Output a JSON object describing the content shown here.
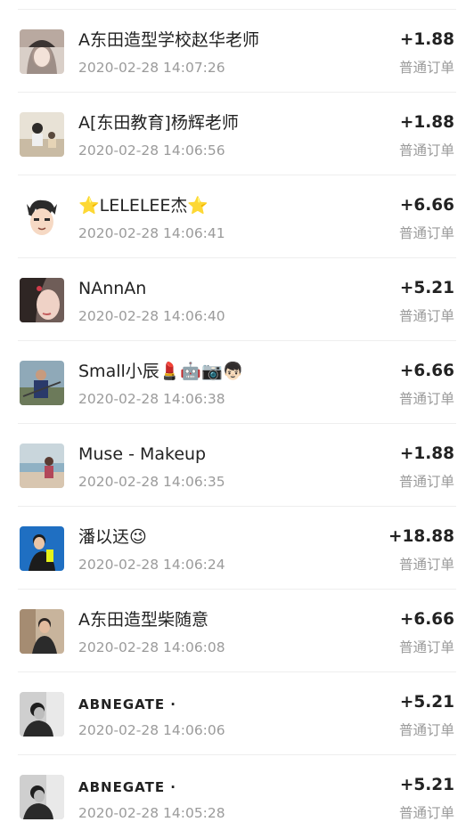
{
  "orders": [
    {
      "name": "A东田造型学校赵华老师",
      "time": "2020-02-28 14:07:26",
      "amount": "+1.88",
      "type": "普通订单",
      "avatar": "avatar-girl-hat-icon"
    },
    {
      "name": "A[东田教育]杨辉老师",
      "time": "2020-02-28 14:06:56",
      "amount": "+1.88",
      "type": "普通订单",
      "avatar": "avatar-classroom-icon"
    },
    {
      "name": "⭐LELELEE杰⭐",
      "time": "2020-02-28 14:06:41",
      "amount": "+6.66",
      "type": "普通订单",
      "avatar": "avatar-cartoon-boy-icon"
    },
    {
      "name": "NAnnAn",
      "time": "2020-02-28 14:06:40",
      "amount": "+5.21",
      "type": "普通订单",
      "avatar": "avatar-girl-portrait-icon"
    },
    {
      "name": "Small小辰💄🤖📷👦🏻",
      "time": "2020-02-28 14:06:38",
      "amount": "+6.66",
      "type": "普通订单",
      "avatar": "avatar-man-outdoor-icon"
    },
    {
      "name": "Muse - Makeup",
      "time": "2020-02-28 14:06:35",
      "amount": "+1.88",
      "type": "普通订单",
      "avatar": "avatar-beach-woman-icon"
    },
    {
      "name": "潘以迗😉",
      "time": "2020-02-28 14:06:24",
      "amount": "+18.88",
      "type": "普通订单",
      "avatar": "avatar-selfie-icon"
    },
    {
      "name": "A东田造型柴随意",
      "time": "2020-02-28 14:06:08",
      "amount": "+6.66",
      "type": "普通订单",
      "avatar": "avatar-man-indoor-icon"
    },
    {
      "name": "ABNEGATE ·",
      "time": "2020-02-28 14:06:06",
      "amount": "+5.21",
      "type": "普通订单",
      "avatar": "avatar-bw-portrait-icon"
    },
    {
      "name": "ABNEGATE ·",
      "time": "2020-02-28 14:05:28",
      "amount": "+5.21",
      "type": "普通订单",
      "avatar": "avatar-bw-portrait-icon"
    }
  ]
}
